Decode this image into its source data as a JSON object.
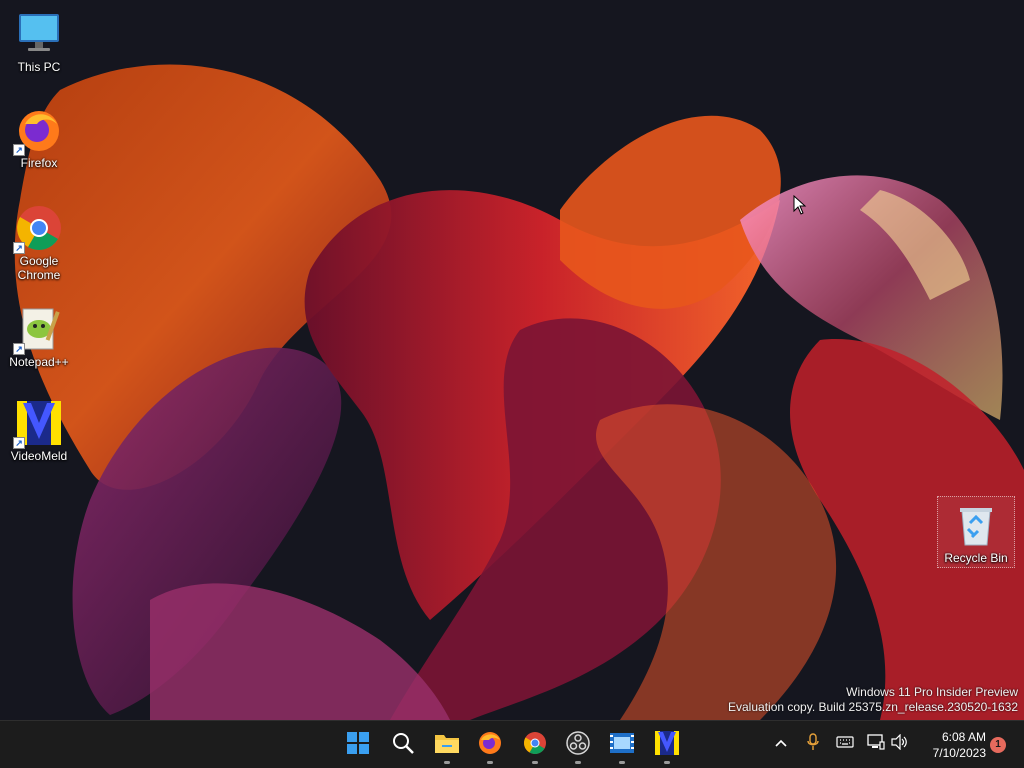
{
  "desktop": {
    "icons": [
      {
        "label": "This PC",
        "icon": "computer-icon"
      },
      {
        "label": "Firefox",
        "icon": "firefox-icon"
      },
      {
        "label": "Google Chrome",
        "icon": "chrome-icon"
      },
      {
        "label": "Notepad++",
        "icon": "notepadpp-icon"
      },
      {
        "label": "VideoMeld",
        "icon": "videomeld-icon"
      },
      {
        "label": "Recycle Bin",
        "icon": "recycle-bin-icon"
      }
    ],
    "watermark": {
      "line1": "Windows 11 Pro Insider Preview",
      "line2": "Evaluation copy. Build 25375.zn_release.230520-1632"
    }
  },
  "taskbar": {
    "apps": [
      {
        "icon": "start-icon",
        "running": false
      },
      {
        "icon": "search-icon",
        "running": false
      },
      {
        "icon": "file-explorer-icon",
        "running": true
      },
      {
        "icon": "firefox-icon",
        "running": true
      },
      {
        "icon": "chrome-icon",
        "running": true
      },
      {
        "icon": "obs-icon",
        "running": true
      },
      {
        "icon": "film-icon",
        "running": true
      },
      {
        "icon": "videomeld-icon",
        "running": true
      }
    ],
    "tray": {
      "icons": [
        "chevron-up-icon",
        "microphone-icon",
        "keyboard-icon",
        "network-icon",
        "volume-icon"
      ],
      "time": "6:08 AM",
      "date": "7/10/2023",
      "notifications": "1"
    }
  },
  "colors": {
    "taskbar_bg": "#1c1c1c",
    "desktop_bg": "#15161f",
    "accent_blue": "#3a9ff0",
    "badge": "#e66a5d"
  }
}
